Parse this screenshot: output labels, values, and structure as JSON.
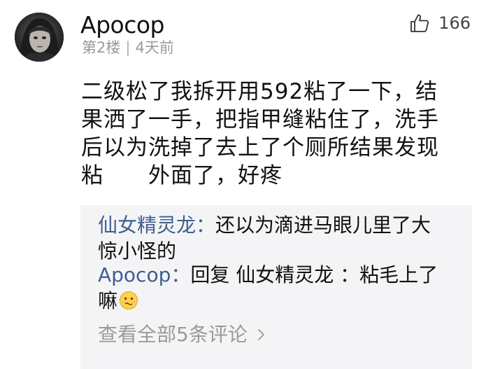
{
  "post": {
    "author": "Apocop",
    "floor": "第2楼",
    "time_ago": "4天前",
    "meta_separator": "|",
    "like_count": "166",
    "content": "二级松了我拆开用592粘了一下，结\n果洒了一手，把指甲缝粘住了，洗手\n后以为洗掉了去上了个厕所结果发现\n粘　　外面了，好疼"
  },
  "replies": {
    "items": [
      {
        "user": "仙女精灵龙",
        "separator": "：",
        "text": "还以为滴进马眼儿里了大惊小怪的"
      },
      {
        "user": "Apocop",
        "separator": "：",
        "text": "回复 仙女精灵龙 ：粘毛上了嘛",
        "emoji": "woozy-face-emoji"
      }
    ],
    "view_all_label": "查看全部5条评论"
  },
  "icons": {
    "like": "thumbs-up-icon",
    "view_all": "chevron-right-icon",
    "avatar": "user-avatar"
  },
  "colors": {
    "username_link": "#3e5f8f",
    "meta_gray": "#9a9a9a",
    "reply_background": "#f4f4f6"
  }
}
